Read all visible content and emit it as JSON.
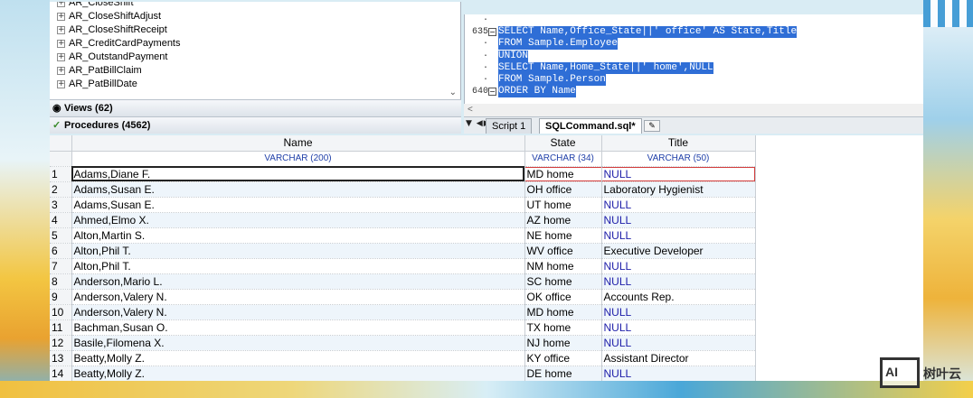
{
  "colors": {
    "selection": "#2f6ed6",
    "null_text": "#1c1ca8",
    "type_text": "#1f3fa8",
    "current_row_border": "#d23c3c"
  },
  "tree": {
    "items": [
      "AR_CloseShift",
      "AR_CloseShiftAdjust",
      "AR_CloseShiftReceipt",
      "AR_CreditCardPayments",
      "AR_OutstandPayment",
      "AR_PatBillClaim",
      "AR_PatBillDate"
    ],
    "views_label": "Views (62)",
    "procedures_label": "Procedures (4562)"
  },
  "editor": {
    "lines": [
      {
        "num": "·",
        "text": "",
        "selected": false,
        "fold": false
      },
      {
        "num": "635",
        "text": "SELECT Name,Office_State||' office' AS State,Title",
        "selected": true,
        "fold": true
      },
      {
        "num": "·",
        "text": "FROM Sample.Employee",
        "selected": true,
        "fold": false
      },
      {
        "num": "·",
        "text": "UNION",
        "selected": true,
        "fold": false
      },
      {
        "num": "·",
        "text": "SELECT Name,Home_State||' home',NULL",
        "selected": true,
        "fold": false
      },
      {
        "num": "·",
        "text": "FROM Sample.Person",
        "selected": true,
        "fold": false
      },
      {
        "num": "640",
        "text": "ORDER BY Name",
        "selected": true,
        "fold": true
      }
    ],
    "scroll_indicator": "<"
  },
  "tabs": {
    "items": [
      {
        "label": "Script 1",
        "active": false
      },
      {
        "label": "SQLCommand.sql*",
        "active": true
      }
    ]
  },
  "grid": {
    "columns": [
      {
        "name": "Name",
        "type": "VARCHAR (200)"
      },
      {
        "name": "State",
        "type": "VARCHAR (34)"
      },
      {
        "name": "Title",
        "type": "VARCHAR (50)"
      }
    ],
    "rows": [
      {
        "n": "1",
        "name": "Adams,Diane F.",
        "state": "MD home",
        "title": "NULL"
      },
      {
        "n": "2",
        "name": "Adams,Susan E.",
        "state": "OH office",
        "title": "Laboratory Hygienist"
      },
      {
        "n": "3",
        "name": "Adams,Susan E.",
        "state": "UT home",
        "title": "NULL"
      },
      {
        "n": "4",
        "name": "Ahmed,Elmo X.",
        "state": "AZ home",
        "title": "NULL"
      },
      {
        "n": "5",
        "name": "Alton,Martin S.",
        "state": "NE home",
        "title": "NULL"
      },
      {
        "n": "6",
        "name": "Alton,Phil T.",
        "state": "WV office",
        "title": "Executive Developer"
      },
      {
        "n": "7",
        "name": "Alton,Phil T.",
        "state": "NM home",
        "title": "NULL"
      },
      {
        "n": "8",
        "name": "Anderson,Mario L.",
        "state": "SC home",
        "title": "NULL"
      },
      {
        "n": "9",
        "name": "Anderson,Valery N.",
        "state": "OK office",
        "title": "Accounts Rep."
      },
      {
        "n": "10",
        "name": "Anderson,Valery N.",
        "state": "MD home",
        "title": "NULL"
      },
      {
        "n": "11",
        "name": "Bachman,Susan O.",
        "state": "TX home",
        "title": "NULL"
      },
      {
        "n": "12",
        "name": "Basile,Filomena X.",
        "state": "NJ home",
        "title": "NULL"
      },
      {
        "n": "13",
        "name": "Beatty,Molly Z.",
        "state": "KY office",
        "title": "Assistant Director"
      },
      {
        "n": "14",
        "name": "Beatty,Molly Z.",
        "state": "DE home",
        "title": "NULL"
      }
    ]
  },
  "watermark": {
    "box": "AI",
    "text": "树叶云"
  }
}
